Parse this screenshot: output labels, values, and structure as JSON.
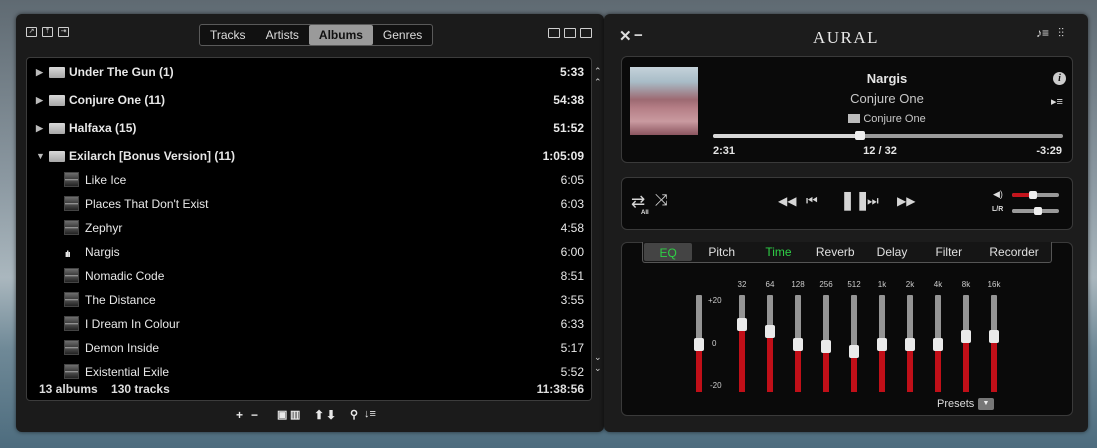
{
  "playlist": {
    "tabs": [
      "Tracks",
      "Artists",
      "Albums",
      "Genres"
    ],
    "active_tab": "Albums",
    "groups": [
      {
        "name": "Under The Gun (1)",
        "duration": "5:33"
      },
      {
        "name": "Conjure One (11)",
        "duration": "54:38"
      },
      {
        "name": "Halfaxa (15)",
        "duration": "51:52"
      },
      {
        "name": "Exilarch [Bonus Version] (11)",
        "duration": "1:05:09"
      }
    ],
    "tracks": [
      {
        "name": "Like Ice",
        "duration": "6:05"
      },
      {
        "name": "Places That Don't Exist",
        "duration": "6:03"
      },
      {
        "name": "Zephyr",
        "duration": "4:58"
      },
      {
        "name": "Nargis",
        "duration": "6:00",
        "playing": true
      },
      {
        "name": "Nomadic Code",
        "duration": "8:51"
      },
      {
        "name": "The Distance",
        "duration": "3:55"
      },
      {
        "name": "I Dream In Colour",
        "duration": "6:33"
      },
      {
        "name": "Demon Inside",
        "duration": "5:17"
      },
      {
        "name": "Existential Exile",
        "duration": "5:52"
      }
    ],
    "summary": {
      "albums": "13 albums",
      "tracks": "130 tracks",
      "total": "11:38:56"
    },
    "bottom_icons": {
      "add": "+",
      "remove": "−",
      "up": "⬆",
      "down": "⬇"
    }
  },
  "player": {
    "title": "AURAL",
    "now_playing": {
      "track": "Nargis",
      "artist": "Conjure One",
      "album": "Conjure One",
      "elapsed": "2:31",
      "position": "12 / 32",
      "remaining": "-3:29",
      "progress_fraction": 0.42
    },
    "repeat_label": "All",
    "volume_fraction": 0.45,
    "balance_fraction": 0.55,
    "balance_label": "L/R",
    "effects_tabs": [
      "EQ",
      "Pitch",
      "Time",
      "Reverb",
      "Delay",
      "Filter",
      "Recorder"
    ],
    "active_effect_tab": "EQ",
    "enabled_effects": [
      "Time"
    ],
    "eq": {
      "db_labels": [
        "+20",
        "0",
        "-20"
      ],
      "bands": [
        {
          "label": "",
          "gain": 0
        },
        {
          "label": "32",
          "gain": 8
        },
        {
          "label": "64",
          "gain": 5
        },
        {
          "label": "128",
          "gain": 0
        },
        {
          "label": "256",
          "gain": -1
        },
        {
          "label": "512",
          "gain": -3
        },
        {
          "label": "1k",
          "gain": 0
        },
        {
          "label": "2k",
          "gain": 0
        },
        {
          "label": "4k",
          "gain": 0
        },
        {
          "label": "8k",
          "gain": 3
        },
        {
          "label": "16k",
          "gain": 3
        }
      ],
      "presets_label": "Presets"
    }
  },
  "colors": {
    "accent_green": "#2fcf46",
    "accent_red": "#c10f18"
  }
}
